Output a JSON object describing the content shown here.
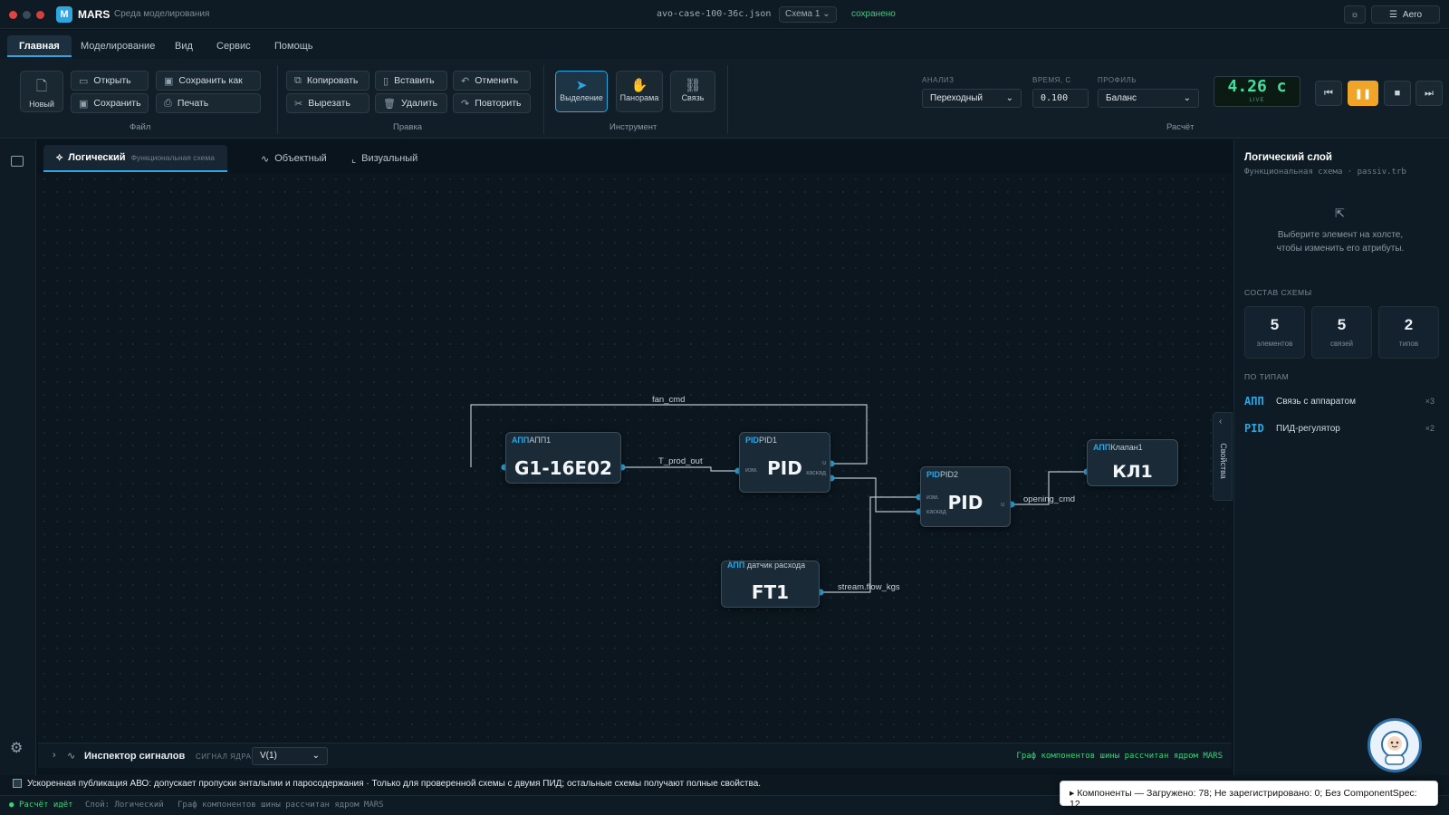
{
  "titlebar": {
    "logo": "M",
    "app_name": "MARS",
    "subtitle": "Среда моделирования",
    "filename": "avo-case-100-36c.json",
    "schema": "Схема 1",
    "save_state": "сохранено",
    "theme_label": "Aero"
  },
  "menu": [
    "Главная",
    "Моделирование",
    "Вид",
    "Сервис",
    "Помощь"
  ],
  "ribbon": {
    "file": {
      "new": "Новый",
      "open": "Открыть",
      "save_as": "Сохранить как",
      "save": "Сохранить",
      "print": "Печать",
      "group": "Файл"
    },
    "edit": {
      "copy": "Копировать",
      "paste": "Вставить",
      "undo": "Отменить",
      "cut": "Вырезать",
      "delete": "Удалить",
      "redo": "Повторить",
      "group": "Правка"
    },
    "tools": {
      "select": "Выделение",
      "pan": "Панорама",
      "link": "Связь",
      "group": "Инструмент"
    },
    "calc": {
      "analysis_label": "АНАЛИЗ",
      "analysis_value": "Переходный",
      "time_label": "ВРЕМЯ, С",
      "time_value": "0.100",
      "profile_label": "ПРОФИЛЬ",
      "profile_value": "Баланс",
      "group": "Расчёт"
    },
    "live": {
      "value": "4.26 с",
      "label": "LIVE"
    }
  },
  "tabs": [
    {
      "label": "Логический",
      "sub": "Функциональная схема"
    },
    {
      "label": "Объектный"
    },
    {
      "label": "Визуальный"
    }
  ],
  "nodes": {
    "app1": {
      "type": "АПП",
      "name": "АПП1",
      "title": "G1-16E02"
    },
    "pid1": {
      "type": "PID",
      "name": "PID1",
      "title": "PID"
    },
    "pid2": {
      "type": "PID",
      "name": "PID2",
      "title": "PID"
    },
    "valve": {
      "type": "АПП",
      "name": "Клапан1",
      "title": "КЛ1"
    },
    "ft1": {
      "type": "АПП",
      "name": "датчик расхода",
      "title": "FT1"
    }
  },
  "ports": {
    "meas": "изм.",
    "cascade": "каскад",
    "u": "u"
  },
  "wires": {
    "fan_cmd": "fan_cmd",
    "t_prod": "T_prod_out",
    "opening": "opening_cmd",
    "flow": "stream.flow_kgs"
  },
  "panel": {
    "title": "Логический слой",
    "subtitle": "Функциональная схема · passiv.trb",
    "hint": "Выберите элемент на холсте, чтобы изменить его атрибуты.",
    "composition_label": "СОСТАВ СХЕМЫ",
    "stats": [
      {
        "n": "5",
        "t": "элементов"
      },
      {
        "n": "5",
        "t": "связей"
      },
      {
        "n": "2",
        "t": "типов"
      }
    ],
    "by_type_label": "ПО ТИПАМ",
    "types": [
      {
        "code": "АПП",
        "name": "Связь с аппаратом",
        "count": "×3"
      },
      {
        "code": "PID",
        "name": "ПИД-регулятор",
        "count": "×2"
      }
    ],
    "props_tab": "Свойства"
  },
  "inspector": {
    "title": "Инспектор сигналов",
    "signal_label": "СИГНАЛ ЯДРА",
    "signal_value": "V(1)",
    "right_text": "Граф компонентов шины рассчитан ядром MARS"
  },
  "notice": "Ускоренная публикация АВО: допускает пропуски энтальпии и паросодержания · Только для проверенной схемы с двумя ПИД; остальные схемы получают полные свойства.",
  "status": {
    "calc": "Расчёт идёт",
    "layer": "Слой: Логический",
    "graph": "Граф компонентов шины рассчитан ядром MARS"
  },
  "toast": "▸ Компоненты — Загружено: 78; Не зарегистрировано: 0; Без ComponentSpec: 12"
}
